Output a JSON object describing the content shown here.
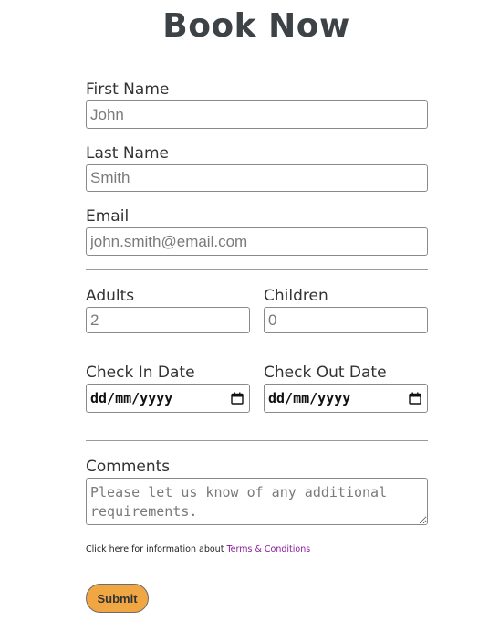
{
  "form": {
    "title": "Book Now",
    "first_name": {
      "label": "First Name",
      "placeholder": "John"
    },
    "last_name": {
      "label": "Last Name",
      "placeholder": "Smith"
    },
    "email": {
      "label": "Email",
      "placeholder": "john.smith@email.com"
    },
    "adults": {
      "label": "Adults",
      "placeholder": "2"
    },
    "children": {
      "label": "Children",
      "placeholder": "0"
    },
    "check_in": {
      "label": "Check In Date",
      "format": "dd/mm/yyyy",
      "icon": "calendar-icon"
    },
    "check_out": {
      "label": "Check Out Date",
      "format": "dd/mm/yyyy",
      "icon": "calendar-icon"
    },
    "comments": {
      "label": "Comments",
      "placeholder": "Please let us know of any additional requirements."
    },
    "terms": {
      "prefix": "Click here for information about",
      "link": "Terms & Conditions"
    },
    "submit_label": "Submit"
  },
  "colors": {
    "submit_bg": "#f0a743",
    "link": "#8a1c9b",
    "title": "#3c4245"
  }
}
